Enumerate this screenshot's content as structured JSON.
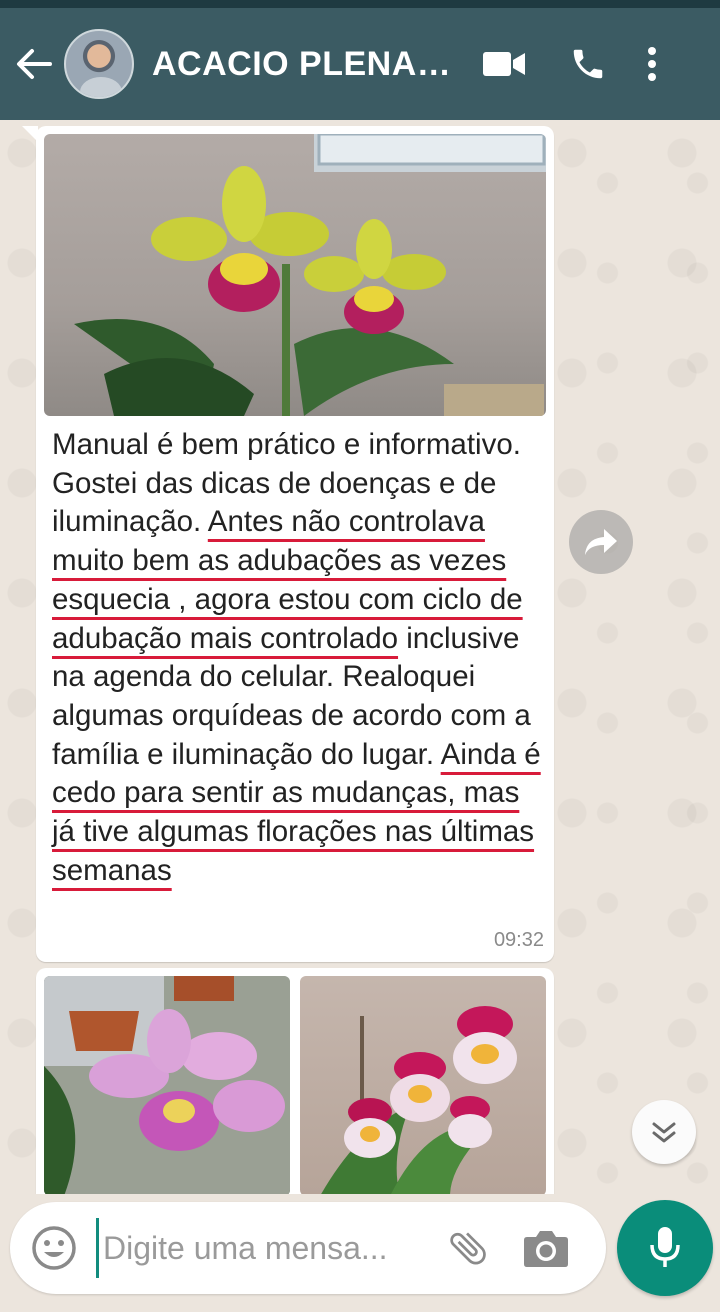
{
  "header": {
    "contact_name": "ACACIO PLENAS...",
    "icons": {
      "back": "arrow-left-icon",
      "video": "video-camera-icon",
      "call": "phone-icon",
      "menu": "more-vertical-icon"
    }
  },
  "messages": [
    {
      "type": "image-with-caption",
      "image_subject": "yellow and magenta cattleya orchids",
      "caption_segments": [
        {
          "text": "Manual é bem prático e informativo. Gostei das dicas de doenças e de iluminação. ",
          "underlined": false
        },
        {
          "text": "Antes não controlava muito bem as adubações as vezes esquecia , agora estou com ciclo de adubação mais controlado",
          "underlined": true
        },
        {
          "text": " inclusive na agenda do celular. Realoquei algumas orquídeas de acordo com      a família e iluminação do lugar. ",
          "underlined": false
        },
        {
          "text": "Ainda é cedo para sentir as mudanças, mas já tive algumas florações nas últimas semanas",
          "underlined": true
        }
      ],
      "time": "09:32"
    },
    {
      "type": "image-grid",
      "images": [
        "pink cattleya orchids",
        "pink and white miltonia orchids"
      ]
    }
  ],
  "composer": {
    "placeholder": "Digite uma mensa...",
    "icons": {
      "emoji": "smiley-icon",
      "attach": "paperclip-icon",
      "camera": "camera-icon",
      "mic": "microphone-icon"
    }
  },
  "floating": {
    "forward": "forward-arrow-icon",
    "scroll_down": "double-chevron-down-icon"
  },
  "colors": {
    "header": "#3b5b63",
    "accent": "#0a8d7a",
    "chat_bg": "#ece5dd",
    "underline": "#d81b3a"
  }
}
